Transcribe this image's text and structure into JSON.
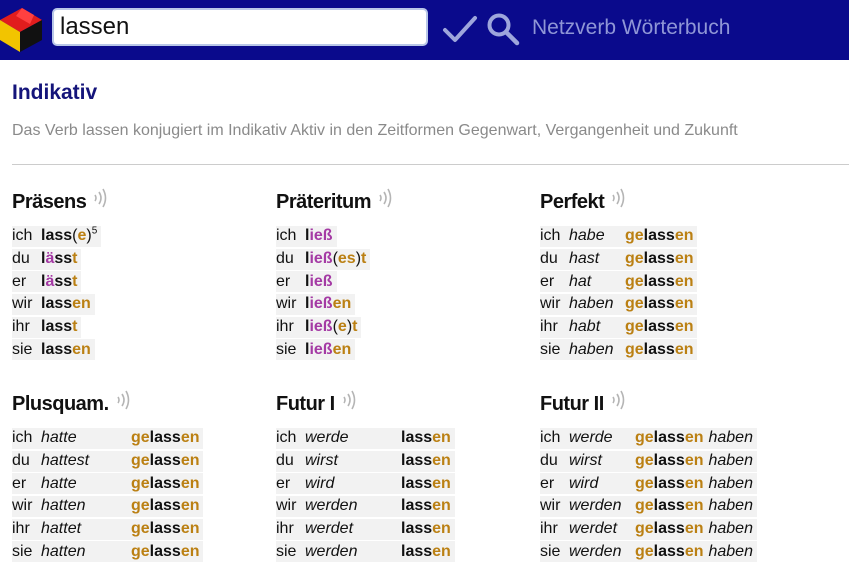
{
  "header": {
    "search_value": "lassen",
    "brand": "Netzverb Wörterbuch",
    "colors": {
      "bar": "#0a0a8c",
      "brand_text": "#8f96d6"
    }
  },
  "page": {
    "title": "Indikativ",
    "subtitle": "Das Verb lassen konjugiert im Indikativ Aktiv in den Zeitformen Gegenwart, Vergangenheit und Zukunft"
  },
  "colors": {
    "ending": "#bb8013",
    "umlaut": "#a43aa4",
    "title": "#14147a"
  },
  "tenses": [
    {
      "name": "Präsens",
      "rows": [
        {
          "pron": "ich",
          "parts": [
            {
              "t": "lass",
              "c": "stem"
            },
            {
              "t": "(",
              "c": "paren"
            },
            {
              "t": "e",
              "c": "end"
            },
            {
              "t": ")",
              "c": "paren"
            },
            {
              "t": "5",
              "c": "sup"
            }
          ]
        },
        {
          "pron": "du",
          "parts": [
            {
              "t": "l",
              "c": "stem"
            },
            {
              "t": "ä",
              "c": "umlaut"
            },
            {
              "t": "ss",
              "c": "stem"
            },
            {
              "t": "t",
              "c": "end"
            }
          ]
        },
        {
          "pron": "er",
          "parts": [
            {
              "t": "l",
              "c": "stem"
            },
            {
              "t": "ä",
              "c": "umlaut"
            },
            {
              "t": "ss",
              "c": "stem"
            },
            {
              "t": "t",
              "c": "end"
            }
          ]
        },
        {
          "pron": "wir",
          "parts": [
            {
              "t": "lass",
              "c": "stem"
            },
            {
              "t": "en",
              "c": "end"
            }
          ]
        },
        {
          "pron": "ihr",
          "parts": [
            {
              "t": "lass",
              "c": "stem"
            },
            {
              "t": "t",
              "c": "end"
            }
          ]
        },
        {
          "pron": "sie",
          "parts": [
            {
              "t": "lass",
              "c": "stem"
            },
            {
              "t": "en",
              "c": "end"
            }
          ]
        }
      ]
    },
    {
      "name": "Präteritum",
      "rows": [
        {
          "pron": "ich",
          "parts": [
            {
              "t": "l",
              "c": "stem"
            },
            {
              "t": "ieß",
              "c": "umlaut"
            }
          ]
        },
        {
          "pron": "du",
          "parts": [
            {
              "t": "l",
              "c": "stem"
            },
            {
              "t": "ieß",
              "c": "umlaut"
            },
            {
              "t": "(",
              "c": "paren"
            },
            {
              "t": "es",
              "c": "end"
            },
            {
              "t": ")",
              "c": "paren"
            },
            {
              "t": "t",
              "c": "end"
            }
          ]
        },
        {
          "pron": "er",
          "parts": [
            {
              "t": "l",
              "c": "stem"
            },
            {
              "t": "ieß",
              "c": "umlaut"
            }
          ]
        },
        {
          "pron": "wir",
          "parts": [
            {
              "t": "l",
              "c": "stem"
            },
            {
              "t": "ieß",
              "c": "umlaut"
            },
            {
              "t": "en",
              "c": "end"
            }
          ]
        },
        {
          "pron": "ihr",
          "parts": [
            {
              "t": "l",
              "c": "stem"
            },
            {
              "t": "ieß",
              "c": "umlaut"
            },
            {
              "t": "(",
              "c": "paren"
            },
            {
              "t": "e",
              "c": "end"
            },
            {
              "t": ")",
              "c": "paren"
            },
            {
              "t": "t",
              "c": "end"
            }
          ]
        },
        {
          "pron": "sie",
          "parts": [
            {
              "t": "l",
              "c": "stem"
            },
            {
              "t": "ieß",
              "c": "umlaut"
            },
            {
              "t": "en",
              "c": "end"
            }
          ]
        }
      ]
    },
    {
      "name": "Perfekt",
      "rows": [
        {
          "pron": "ich",
          "aux": "habe",
          "parts": [
            {
              "t": "ge",
              "c": "pref"
            },
            {
              "t": "lass",
              "c": "stem"
            },
            {
              "t": "en",
              "c": "end"
            }
          ]
        },
        {
          "pron": "du",
          "aux": "hast",
          "parts": [
            {
              "t": "ge",
              "c": "pref"
            },
            {
              "t": "lass",
              "c": "stem"
            },
            {
              "t": "en",
              "c": "end"
            }
          ]
        },
        {
          "pron": "er",
          "aux": "hat",
          "parts": [
            {
              "t": "ge",
              "c": "pref"
            },
            {
              "t": "lass",
              "c": "stem"
            },
            {
              "t": "en",
              "c": "end"
            }
          ]
        },
        {
          "pron": "wir",
          "aux": "haben",
          "parts": [
            {
              "t": "ge",
              "c": "pref"
            },
            {
              "t": "lass",
              "c": "stem"
            },
            {
              "t": "en",
              "c": "end"
            }
          ]
        },
        {
          "pron": "ihr",
          "aux": "habt",
          "parts": [
            {
              "t": "ge",
              "c": "pref"
            },
            {
              "t": "lass",
              "c": "stem"
            },
            {
              "t": "en",
              "c": "end"
            }
          ]
        },
        {
          "pron": "sie",
          "aux": "haben",
          "parts": [
            {
              "t": "ge",
              "c": "pref"
            },
            {
              "t": "lass",
              "c": "stem"
            },
            {
              "t": "en",
              "c": "end"
            }
          ]
        }
      ]
    },
    {
      "name": "Plusquam.",
      "rows": [
        {
          "pron": "ich",
          "aux": "hatte",
          "parts": [
            {
              "t": "ge",
              "c": "pref"
            },
            {
              "t": "lass",
              "c": "stem"
            },
            {
              "t": "en",
              "c": "end"
            }
          ]
        },
        {
          "pron": "du",
          "aux": "hattest",
          "parts": [
            {
              "t": "ge",
              "c": "pref"
            },
            {
              "t": "lass",
              "c": "stem"
            },
            {
              "t": "en",
              "c": "end"
            }
          ]
        },
        {
          "pron": "er",
          "aux": "hatte",
          "parts": [
            {
              "t": "ge",
              "c": "pref"
            },
            {
              "t": "lass",
              "c": "stem"
            },
            {
              "t": "en",
              "c": "end"
            }
          ]
        },
        {
          "pron": "wir",
          "aux": "hatten",
          "parts": [
            {
              "t": "ge",
              "c": "pref"
            },
            {
              "t": "lass",
              "c": "stem"
            },
            {
              "t": "en",
              "c": "end"
            }
          ]
        },
        {
          "pron": "ihr",
          "aux": "hattet",
          "parts": [
            {
              "t": "ge",
              "c": "pref"
            },
            {
              "t": "lass",
              "c": "stem"
            },
            {
              "t": "en",
              "c": "end"
            }
          ]
        },
        {
          "pron": "sie",
          "aux": "hatten",
          "parts": [
            {
              "t": "ge",
              "c": "pref"
            },
            {
              "t": "lass",
              "c": "stem"
            },
            {
              "t": "en",
              "c": "end"
            }
          ]
        }
      ]
    },
    {
      "name": "Futur I",
      "rows": [
        {
          "pron": "ich",
          "aux": "werde",
          "parts": [
            {
              "t": "lass",
              "c": "stem"
            },
            {
              "t": "en",
              "c": "end"
            }
          ]
        },
        {
          "pron": "du",
          "aux": "wirst",
          "parts": [
            {
              "t": "lass",
              "c": "stem"
            },
            {
              "t": "en",
              "c": "end"
            }
          ]
        },
        {
          "pron": "er",
          "aux": "wird",
          "parts": [
            {
              "t": "lass",
              "c": "stem"
            },
            {
              "t": "en",
              "c": "end"
            }
          ]
        },
        {
          "pron": "wir",
          "aux": "werden",
          "parts": [
            {
              "t": "lass",
              "c": "stem"
            },
            {
              "t": "en",
              "c": "end"
            }
          ]
        },
        {
          "pron": "ihr",
          "aux": "werdet",
          "parts": [
            {
              "t": "lass",
              "c": "stem"
            },
            {
              "t": "en",
              "c": "end"
            }
          ]
        },
        {
          "pron": "sie",
          "aux": "werden",
          "parts": [
            {
              "t": "lass",
              "c": "stem"
            },
            {
              "t": "en",
              "c": "end"
            }
          ]
        }
      ]
    },
    {
      "name": "Futur II",
      "rows": [
        {
          "pron": "ich",
          "aux": "werde",
          "parts": [
            {
              "t": "ge",
              "c": "pref"
            },
            {
              "t": "lass",
              "c": "stem"
            },
            {
              "t": "en",
              "c": "end"
            }
          ],
          "after": "haben"
        },
        {
          "pron": "du",
          "aux": "wirst",
          "parts": [
            {
              "t": "ge",
              "c": "pref"
            },
            {
              "t": "lass",
              "c": "stem"
            },
            {
              "t": "en",
              "c": "end"
            }
          ],
          "after": "haben"
        },
        {
          "pron": "er",
          "aux": "wird",
          "parts": [
            {
              "t": "ge",
              "c": "pref"
            },
            {
              "t": "lass",
              "c": "stem"
            },
            {
              "t": "en",
              "c": "end"
            }
          ],
          "after": "haben"
        },
        {
          "pron": "wir",
          "aux": "werden",
          "parts": [
            {
              "t": "ge",
              "c": "pref"
            },
            {
              "t": "lass",
              "c": "stem"
            },
            {
              "t": "en",
              "c": "end"
            }
          ],
          "after": "haben"
        },
        {
          "pron": "ihr",
          "aux": "werdet",
          "parts": [
            {
              "t": "ge",
              "c": "pref"
            },
            {
              "t": "lass",
              "c": "stem"
            },
            {
              "t": "en",
              "c": "end"
            }
          ],
          "after": "haben"
        },
        {
          "pron": "sie",
          "aux": "werden",
          "parts": [
            {
              "t": "ge",
              "c": "pref"
            },
            {
              "t": "lass",
              "c": "stem"
            },
            {
              "t": "en",
              "c": "end"
            }
          ],
          "after": "haben"
        }
      ]
    }
  ]
}
